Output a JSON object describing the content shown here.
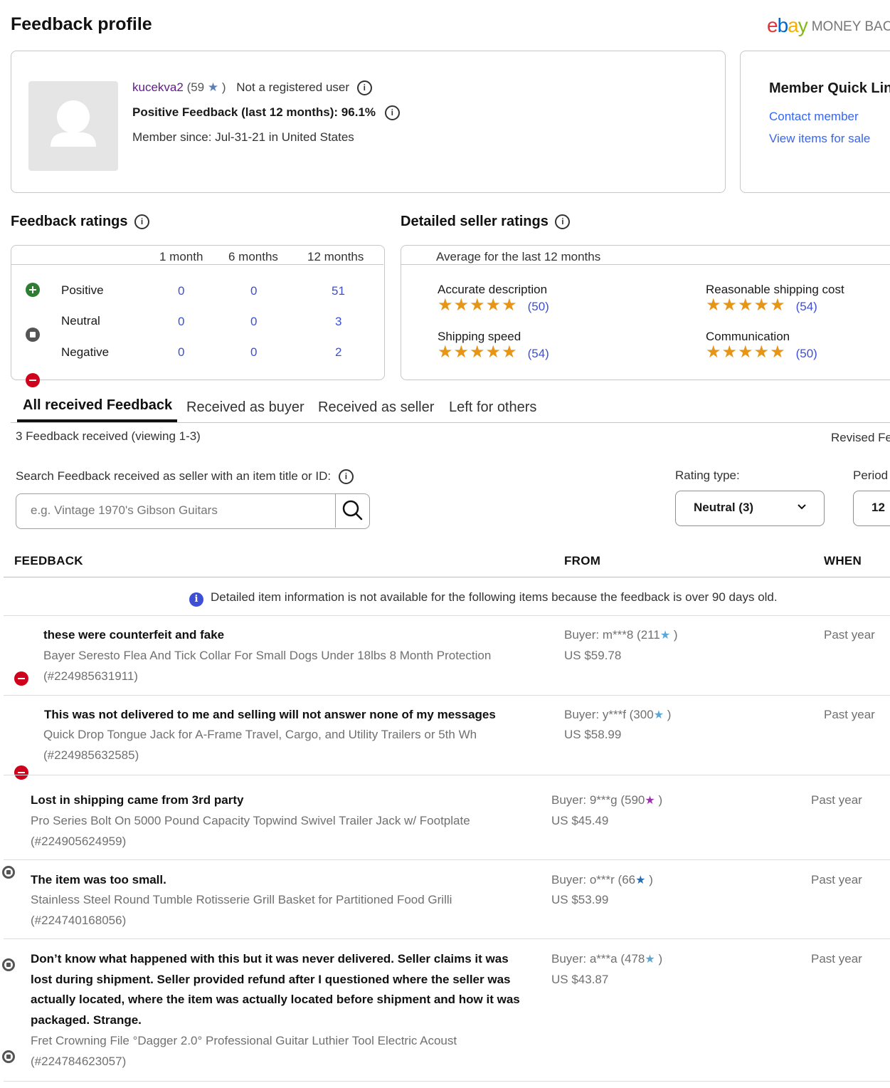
{
  "page": {
    "title": "Feedback profile"
  },
  "logo": {
    "e": "e",
    "b": "b",
    "a": "a",
    "y": "y",
    "tagline": "MONEY BAC"
  },
  "profile": {
    "username": "kucekva2",
    "score_open": "(59",
    "score_close": ")",
    "registration": "Not a registered user",
    "positive_feedback": "Positive Feedback (last 12 months): 96.1%",
    "member_since": "Member since: Jul-31-21 in United States"
  },
  "quick_links": {
    "title": "Member Quick Lin",
    "contact": "Contact member",
    "view_items": "View items for sale"
  },
  "feedback_ratings": {
    "title": "Feedback ratings",
    "columns": [
      "1 month",
      "6 months",
      "12 months"
    ],
    "rows": [
      {
        "label": "Positive",
        "values": [
          "0",
          "0",
          "51"
        ]
      },
      {
        "label": "Neutral",
        "values": [
          "0",
          "0",
          "3"
        ]
      },
      {
        "label": "Negative",
        "values": [
          "0",
          "0",
          "2"
        ]
      }
    ]
  },
  "detailed_ratings": {
    "title": "Detailed seller ratings",
    "subtitle": "Average for the last 12 months",
    "items": [
      {
        "label": "Accurate description",
        "count": "(50)",
        "stars": 5
      },
      {
        "label": "Reasonable shipping cost",
        "count": "(54)",
        "stars": 5
      },
      {
        "label": "Shipping speed",
        "count": "(54)",
        "stars": 5
      },
      {
        "label": "Communication",
        "count": "(50)",
        "stars": 5
      }
    ]
  },
  "tabs": [
    "All received Feedback",
    "Received as buyer",
    "Received as seller",
    "Left for others"
  ],
  "summary": {
    "count_text": "3 Feedback received (viewing 1-3)",
    "revised": "Revised Fe"
  },
  "search": {
    "label": "Search Feedback received as seller with an item title or ID:",
    "placeholder": "e.g. Vintage 1970's Gibson Guitars"
  },
  "filters": {
    "rating_label": "Rating type:",
    "rating_value": "Neutral (3)",
    "period_label": "Period",
    "period_value": "12"
  },
  "table": {
    "headers": {
      "feedback": "FEEDBACK",
      "from": "FROM",
      "when": "WHEN"
    },
    "notice": "Detailed item information is not available for the following items because the feedback is over 90 days old.",
    "rows": [
      {
        "type": "negative",
        "comment": "these were counterfeit and fake",
        "item": "Bayer Seresto Flea And Tick Collar For Small Dogs Under 18lbs 8 Month Protection",
        "id": "(#224985631911)",
        "buyer": "Buyer: m***8 (211",
        "buyer_close": ")",
        "price": "US $59.78",
        "when": "Past year",
        "star_color": "#5ba7d6"
      },
      {
        "type": "negative",
        "comment": "This was not delivered to me and selling will not answer none of my messages",
        "item": "Quick Drop Tongue Jack for A-Frame Travel, Cargo, and Utility Trailers or 5th Wh",
        "id": "(#224985632585)",
        "buyer": "Buyer: y***f (300",
        "buyer_close": ")",
        "price": "US $58.99",
        "when": "Past year",
        "star_color": "#5ba7d6"
      },
      {
        "type": "neutral",
        "comment": "Lost in shipping came from 3rd party",
        "item": "Pro Series Bolt On 5000 Pound Capacity Topwind Swivel Trailer Jack w/ Footplate",
        "id": "(#224905624959)",
        "buyer": "Buyer: 9***g (590",
        "buyer_close": ")",
        "price": "US $45.49",
        "when": "Past year",
        "star_color": "#a12fb3"
      },
      {
        "type": "neutral",
        "comment": "The item was too small.",
        "item": "Stainless Steel Round Tumble Rotisserie Grill Basket for Partitioned Food Grilli",
        "id": "(#224740168056)",
        "buyer": "Buyer: o***r (66",
        "buyer_close": ")",
        "price": "US $53.99",
        "when": "Past year",
        "star_color": "#2a6db0"
      },
      {
        "type": "neutral",
        "comment_lines": [
          "Don’t know what happened with this but it was never delivered. Seller claims it was",
          "lost during shipment. Seller provided refund after I questioned where the seller was",
          "actually located, where the item was actually located before shipment and how it was",
          "packaged. Strange."
        ],
        "item": "Fret Crowning File °Dagger 2.0° Professional Guitar Luthier Tool Electric Acoust",
        "id": "(#224784623057)",
        "buyer": "Buyer: a***a (478",
        "buyer_close": ")",
        "price": "US $43.87",
        "when": "Past year",
        "star_color": "#5ba7d6"
      }
    ]
  }
}
